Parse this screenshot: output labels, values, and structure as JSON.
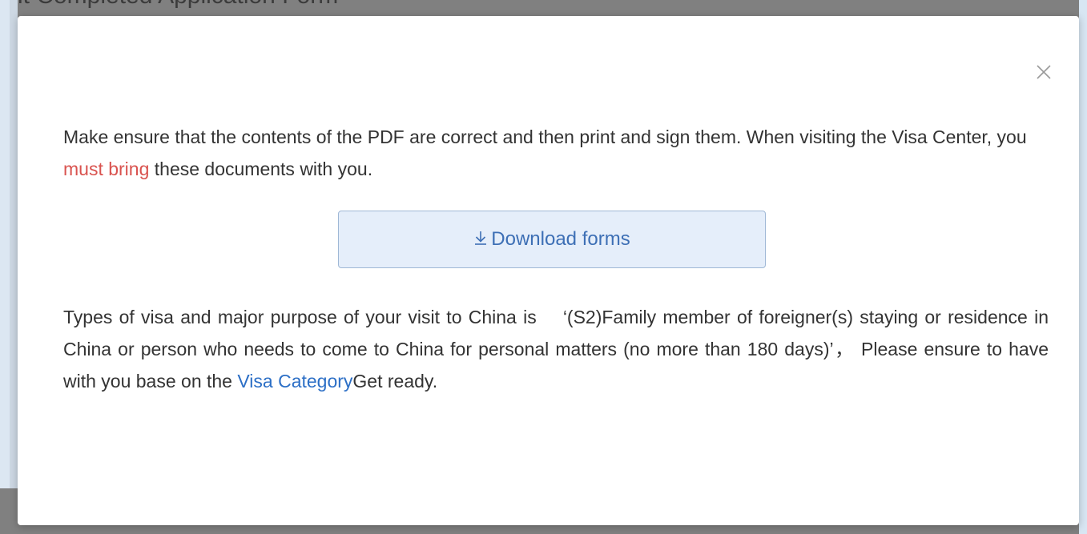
{
  "background": {
    "page_title": "it Completed Application Form"
  },
  "modal": {
    "close_icon": "close-icon",
    "paragraph1": {
      "text_before": "Make ensure that the contents of the PDF are correct and then print and sign them. When visiting the Visa Center, you ",
      "highlight": "must bring",
      "text_after": " these documents with you."
    },
    "download_button": {
      "icon": "download-icon",
      "label": "Download forms"
    },
    "paragraph2": {
      "text_before": "Types of visa and major purpose of your visit to China is 　‘(S2)Family member of foreigner(s) staying or residence in China or person who needs to come to China for personal matters (no more than 180 days)’， Please ensure to have with you base on the ",
      "link": "Visa Category",
      "text_after": "Get ready."
    }
  },
  "colors": {
    "highlight_red": "#d9534f",
    "link_blue": "#2c6fc6",
    "button_bg": "#e5eefa",
    "button_text": "#3d6fb5",
    "overlay": "#808080"
  }
}
